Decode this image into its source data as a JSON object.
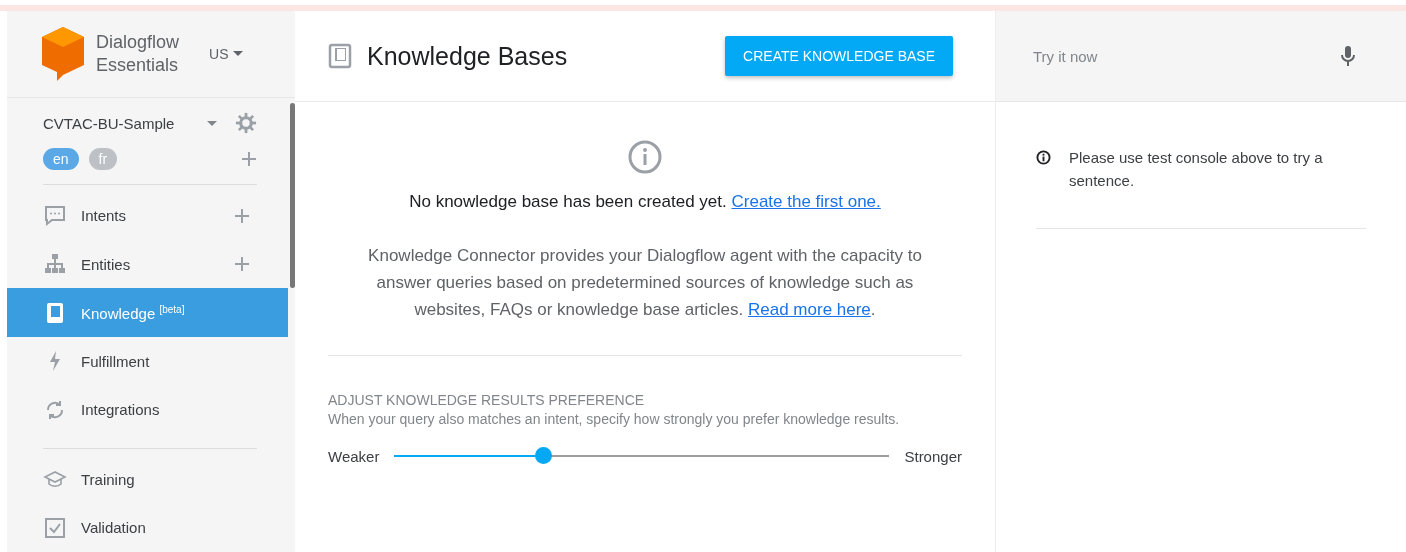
{
  "sidebar": {
    "logo": {
      "line1": "Dialogflow",
      "line2": "Essentials"
    },
    "region": "US",
    "agent": "CVTAC-BU-Sample",
    "languages": [
      {
        "label": "en",
        "selected": true
      },
      {
        "label": "fr",
        "selected": false
      }
    ],
    "groups": [
      [
        {
          "kind": "intents",
          "label": "Intents",
          "selected": false,
          "add": true
        },
        {
          "kind": "entities",
          "label": "Entities",
          "selected": false,
          "add": true
        },
        {
          "kind": "knowledge",
          "label": "Knowledge $^{[beta]}$",
          "selected": true,
          "add": false
        },
        {
          "kind": "fulfillment",
          "label": "Fulfillment",
          "selected": false,
          "add": false
        },
        {
          "kind": "integrations",
          "label": "Integrations",
          "selected": false,
          "add": false
        }
      ],
      [
        {
          "kind": "training",
          "label": "Training",
          "selected": false,
          "add": false
        },
        {
          "kind": "validation",
          "label": "Validation",
          "selected": false,
          "add": false
        }
      ]
    ]
  },
  "main": {
    "title": "Knowledge Bases",
    "create_button": "CREATE KNOWLEDGE BASE",
    "empty_message": "No knowledge base has been created yet.",
    "empty_link": "Create the first one.",
    "description": "Knowledge Connector provides your Dialogflow agent with the capacity to answer queries based on predetermined sources of knowledge such as websites, FAQs or knowledge base articles.",
    "description_link": "Read more here",
    "description_end": ".",
    "preference": {
      "heading": "ADJUST KNOWLEDGE RESULTS PREFERENCE",
      "hint": "When your query also matches an intent, specify how strongly you prefer knowledge results.",
      "min_label": "Weaker",
      "max_label": "Stronger",
      "level": 0.3
    }
  },
  "console": {
    "placeholder": "Try it now",
    "notice": "Please use test console above to try a sentence."
  }
}
